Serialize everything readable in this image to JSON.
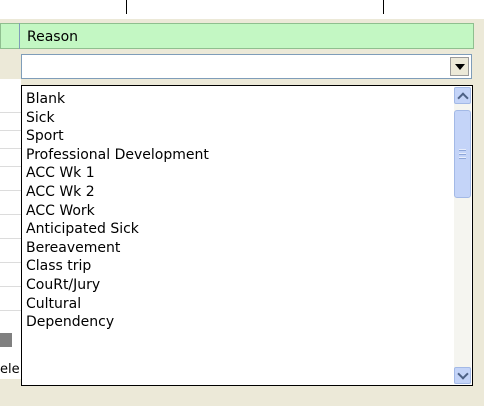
{
  "header": {
    "reason_label": "Reason"
  },
  "combo": {
    "value": ""
  },
  "below_text": "ele... ...",
  "dropdown": {
    "items": [
      "Blank",
      "Sick",
      "Sport",
      "Professional Development",
      "ACC Wk 1",
      "ACC Wk 2",
      "ACC Work",
      "Anticipated Sick",
      "Bereavement",
      "Class trip",
      "CouRt/Jury",
      "Cultural",
      "Dependency"
    ]
  },
  "icons": {
    "combo_button": "chevron-down-icon",
    "scroll_up": "scroll-up-icon",
    "scroll_down": "scroll-down-icon"
  },
  "colors": {
    "header_bg": "#c3f7c3",
    "window_bg": "#ece9d8",
    "scroll_blue": "#c4d4f8"
  }
}
